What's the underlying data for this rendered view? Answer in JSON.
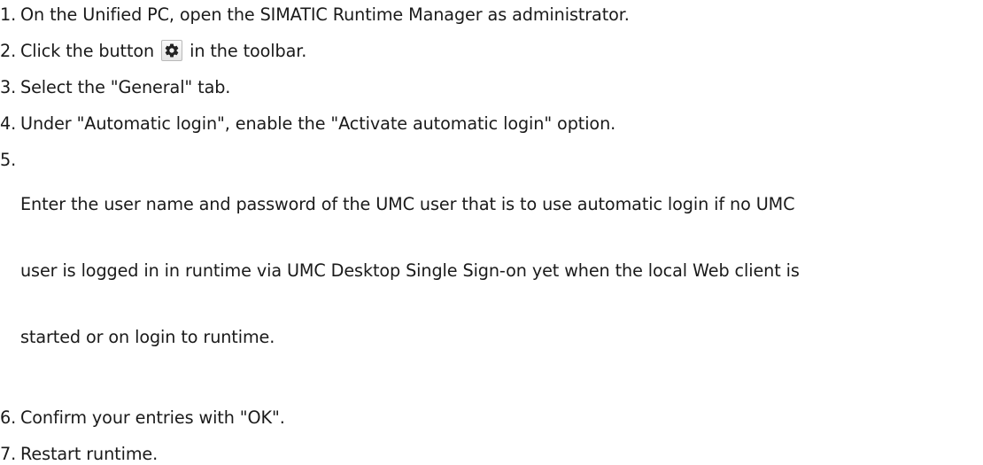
{
  "steps": [
    {
      "number": "1.",
      "text": "On the Unified PC, open the SIMATIC Runtime Manager as administrator."
    },
    {
      "number": "2.",
      "before": "Click the button ",
      "icon": "gear-icon",
      "after": " in the toolbar."
    },
    {
      "number": "3.",
      "text": "Select the \"General\" tab."
    },
    {
      "number": "4.",
      "text": "Under \"Automatic login\", enable the \"Activate automatic login\" option."
    },
    {
      "number": "5.",
      "lines": [
        "Enter the user name and password of the UMC user that is to use automatic login if no UMC",
        "user is logged in in runtime via UMC Desktop Single Sign-on yet when the local Web client is",
        "started or on login to runtime."
      ]
    },
    {
      "number": "6.",
      "text": "Confirm your entries with \"OK\"."
    },
    {
      "number": "7.",
      "text": "Restart runtime."
    }
  ],
  "colors": {
    "text": "#1a1a1a",
    "icon": "#222222",
    "button_border": "#b9b9b9"
  }
}
